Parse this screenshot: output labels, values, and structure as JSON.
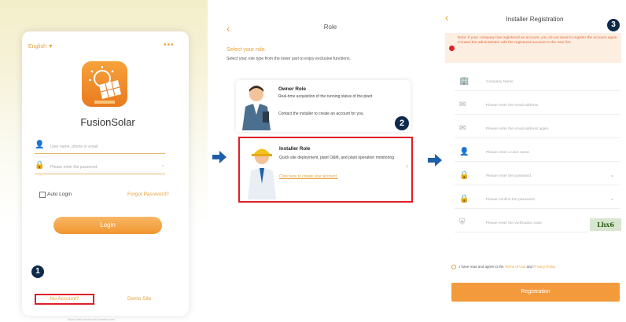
{
  "colors": {
    "accent": "#e8a13a",
    "marker": "#e01f26",
    "badge": "#0d2a4a",
    "arrow": "#1f5fa8"
  },
  "panel1": {
    "language": "English ▼",
    "more": "•••",
    "brand": "FusionSolar",
    "username_placeholder": "User name, phone or email",
    "password_placeholder": "Please enter the password.",
    "auto_login": "Auto Login",
    "forgot_password": "Forgot Password?",
    "login": "Login",
    "step": "1",
    "no_account": "No Account?",
    "demo_site": "Demo Site",
    "url": "https://intl.fusionsolar.huawei.com"
  },
  "panel2": {
    "back": "‹",
    "title": "Role",
    "select_title": "Select your role.",
    "select_desc": "Select your role type from the lower part to enjoy exclusive functions.",
    "owner": {
      "title": "Owner Role",
      "desc": "Real-time acquisition of the running status of the plant",
      "note": "Contact the installer to create an account for you."
    },
    "installer": {
      "title": "Installer Role",
      "desc": "Quick site deployment, plant O&M, and plant operation monitoring",
      "link": "Click here to create your account."
    },
    "step": "2"
  },
  "panel3": {
    "back": "‹",
    "title": "Installer Registration",
    "step": "3",
    "note": "Note: If your company has registered an account, you do not need to register the account again. Contact the administrator add the registered account to the user list.",
    "fields": [
      {
        "icon": "company-icon",
        "placeholder": "Company Name",
        "chevron": false
      },
      {
        "icon": "email-icon",
        "placeholder": "Please enter the email address.",
        "chevron": false
      },
      {
        "icon": "email-icon",
        "placeholder": "Please enter the email address again.",
        "chevron": false
      },
      {
        "icon": "user-icon",
        "placeholder": "Please enter a user name.",
        "chevron": false
      },
      {
        "icon": "lock-icon",
        "placeholder": "Please enter the password.",
        "chevron": true
      },
      {
        "icon": "lock-icon",
        "placeholder": "Please confirm the password.",
        "chevron": true
      },
      {
        "icon": "shield-icon",
        "placeholder": "Please enter the verification code.",
        "chevron": false
      }
    ],
    "captcha": "Lhx6",
    "agree_prefix": "I have read and agree to the",
    "terms": "Terms of Use",
    "and": "and",
    "privacy": "Privacy Policy",
    "register": "Registration"
  }
}
